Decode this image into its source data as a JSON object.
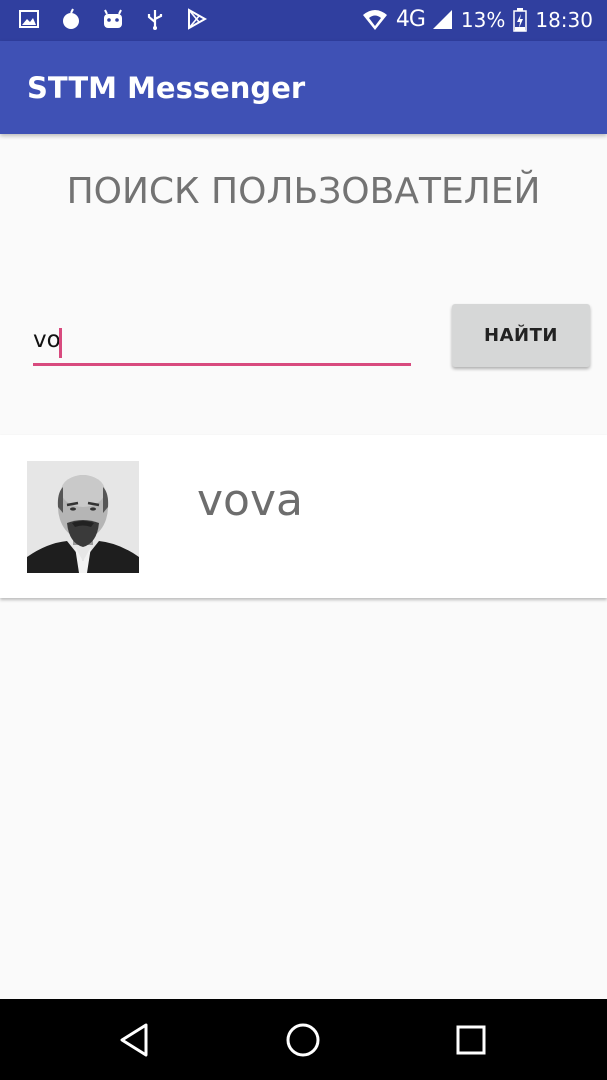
{
  "status_bar": {
    "left_icons": [
      "image-icon",
      "bomb-icon",
      "android-icon",
      "usb-icon",
      "play-store-icon"
    ],
    "network": "4G",
    "battery_percent": "13%",
    "time": "18:30"
  },
  "app_bar": {
    "title": "STTM Messenger"
  },
  "screen": {
    "heading": "ПОИСК ПОЛЬЗОВАТЕЛЕЙ",
    "search": {
      "value": "vo",
      "placeholder": ""
    },
    "find_button": "НАЙТИ"
  },
  "results": [
    {
      "name": "vova",
      "avatar": "user-photo"
    }
  ],
  "nav_bar": {
    "buttons": [
      "back-icon",
      "home-icon",
      "recents-icon"
    ]
  },
  "colors": {
    "status_bar": "#303f9f",
    "app_bar": "#3f51b5",
    "accent": "#d84a7e",
    "button": "#d6d7d7"
  }
}
